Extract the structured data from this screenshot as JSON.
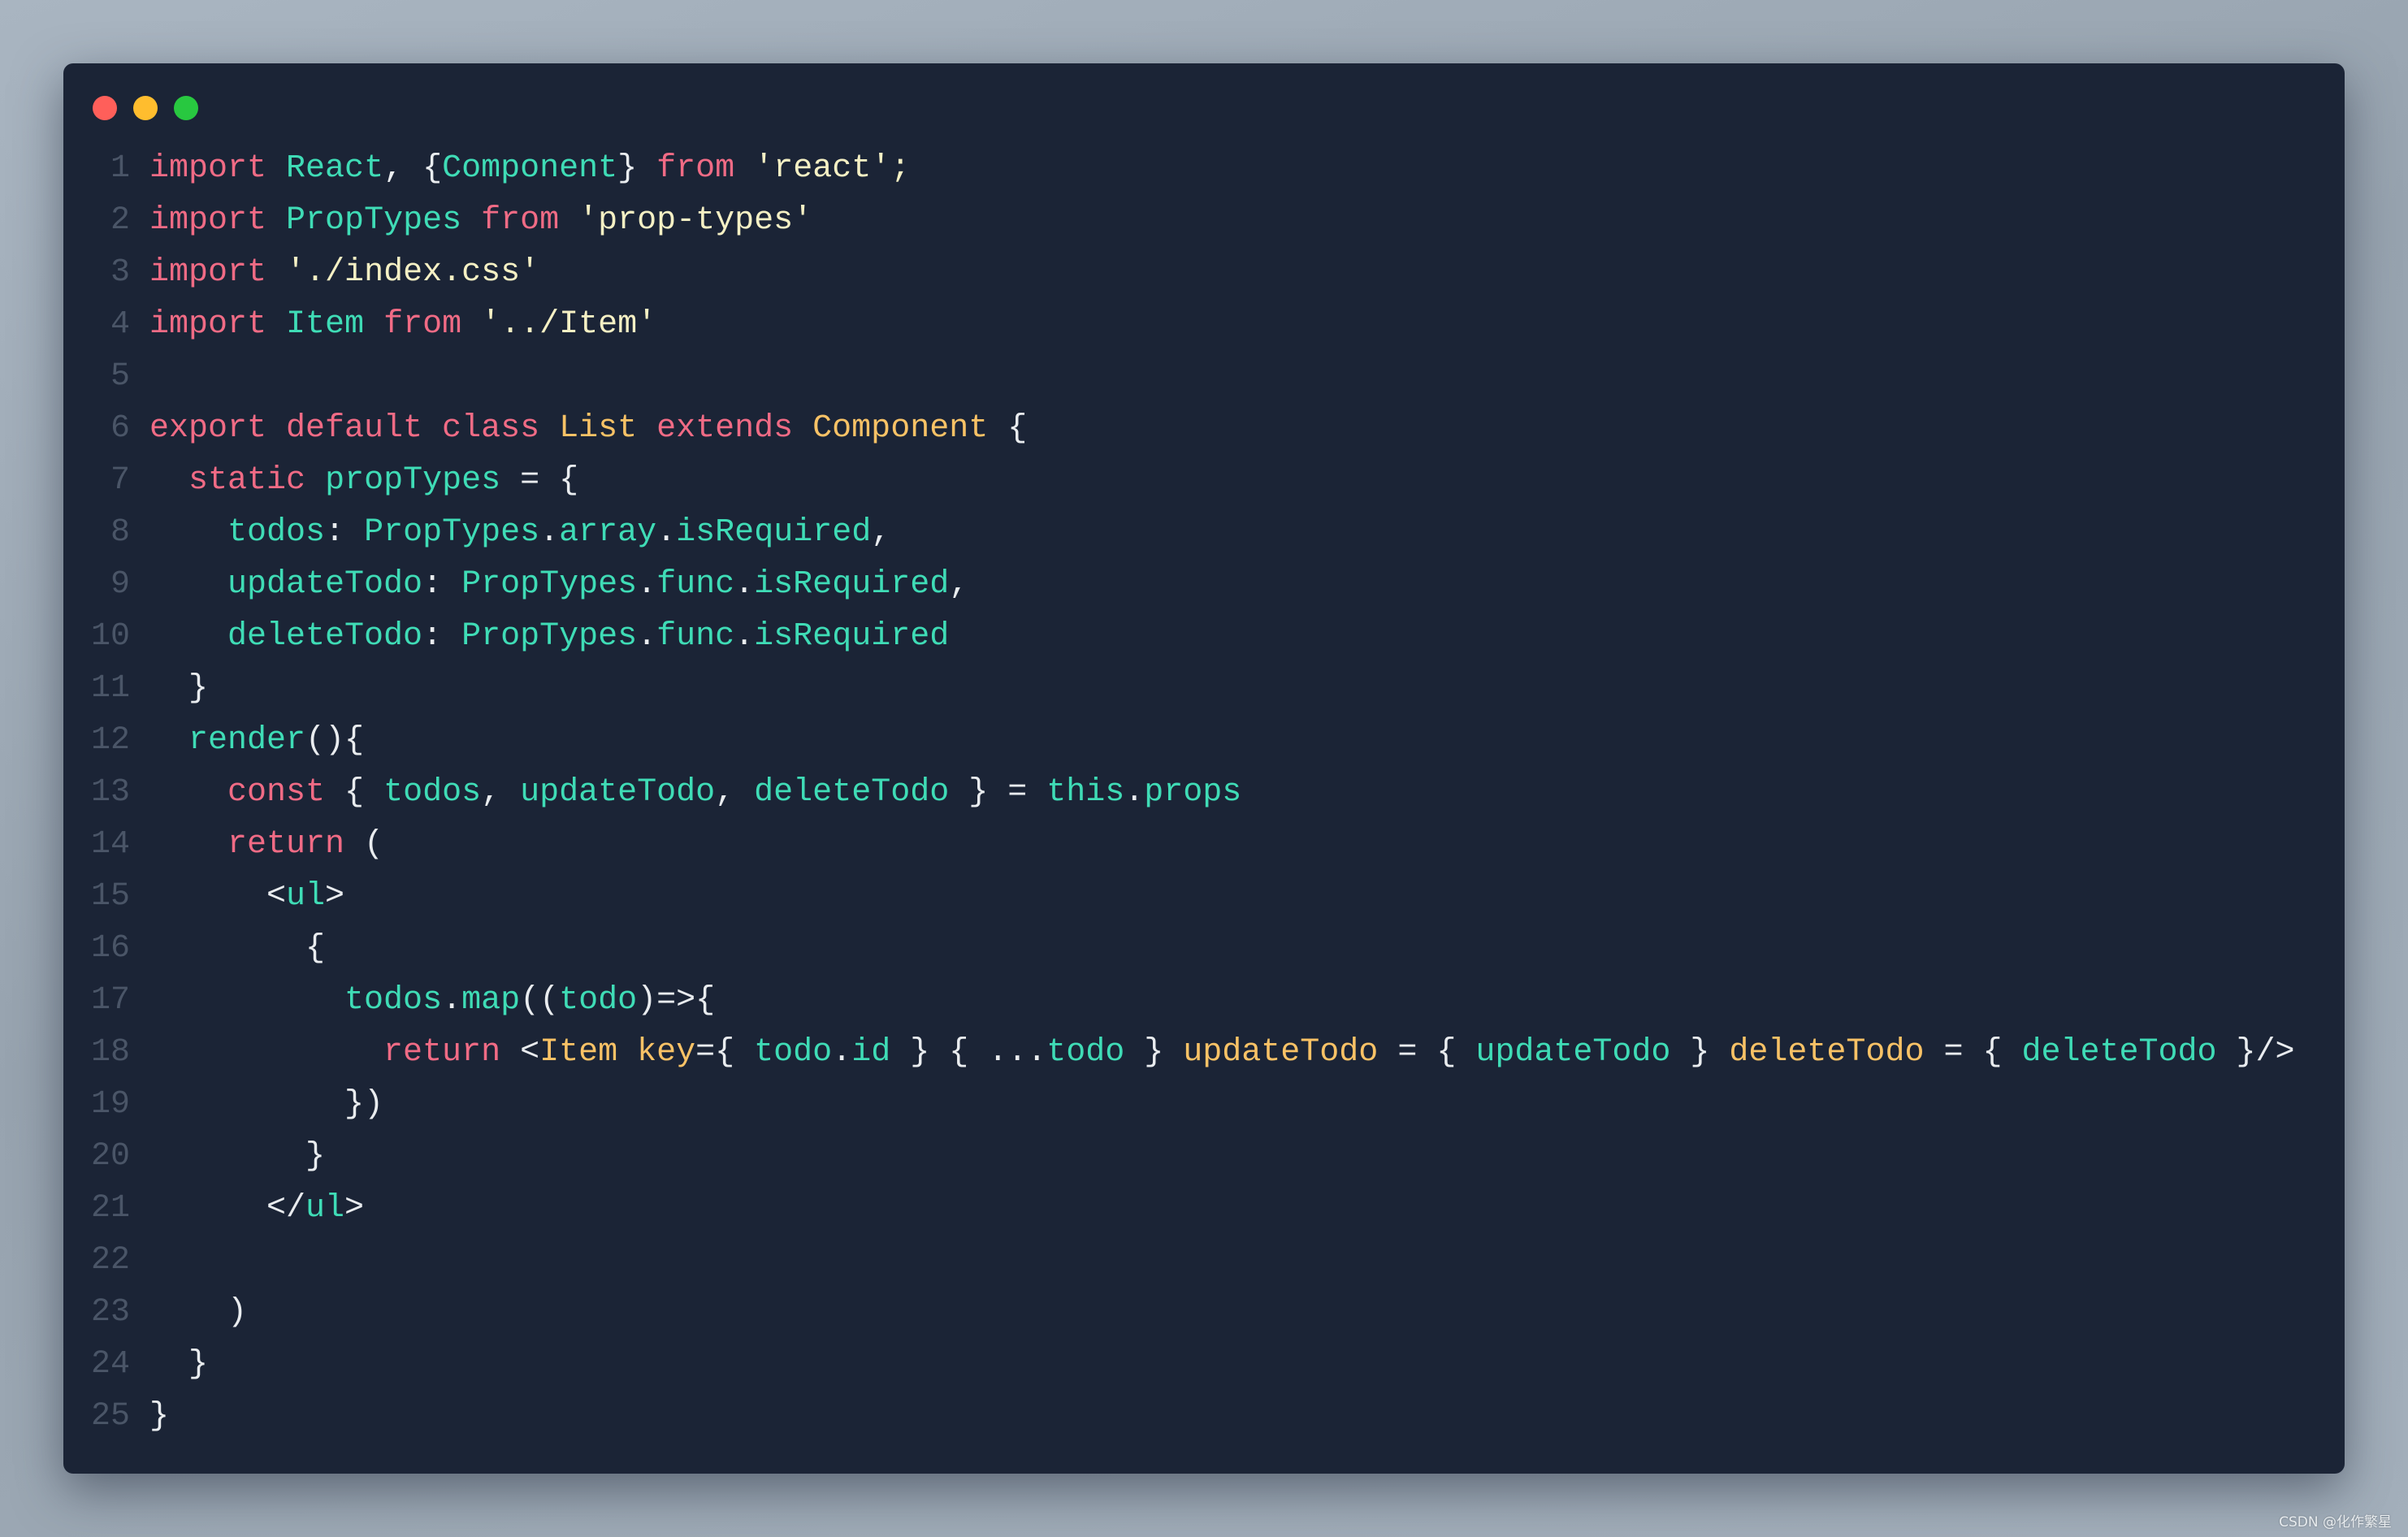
{
  "window": {
    "controls": [
      {
        "name": "close-button",
        "color": "#ff5f5a"
      },
      {
        "name": "minimize-button",
        "color": "#ffbd2e"
      },
      {
        "name": "maximize-button",
        "color": "#28c840"
      }
    ]
  },
  "colors": {
    "background": "#1b2436",
    "keyword": "#f06b85",
    "identifier": "#3fdcb6",
    "string": "#f5f0c4",
    "class": "#f8c266",
    "punctuation": "#e9ecef",
    "line_number": "#4a5567"
  },
  "code": {
    "language": "javascript",
    "lines": [
      {
        "n": "1",
        "tokens": [
          [
            "kw",
            "import"
          ],
          [
            "p",
            " "
          ],
          [
            "id",
            "React"
          ],
          [
            "p",
            ", {"
          ],
          [
            "id",
            "Component"
          ],
          [
            "p",
            "} "
          ],
          [
            "kw",
            "from"
          ],
          [
            "p",
            " "
          ],
          [
            "str",
            "'react';"
          ]
        ]
      },
      {
        "n": "2",
        "tokens": [
          [
            "kw",
            "import"
          ],
          [
            "p",
            " "
          ],
          [
            "id",
            "PropTypes"
          ],
          [
            "p",
            " "
          ],
          [
            "kw",
            "from"
          ],
          [
            "p",
            " "
          ],
          [
            "str",
            "'prop-types'"
          ]
        ]
      },
      {
        "n": "3",
        "tokens": [
          [
            "kw",
            "import"
          ],
          [
            "p",
            " "
          ],
          [
            "str",
            "'./index.css'"
          ]
        ]
      },
      {
        "n": "4",
        "tokens": [
          [
            "kw",
            "import"
          ],
          [
            "p",
            " "
          ],
          [
            "id",
            "Item"
          ],
          [
            "p",
            " "
          ],
          [
            "kw",
            "from"
          ],
          [
            "p",
            " "
          ],
          [
            "str",
            "'../Item'"
          ]
        ]
      },
      {
        "n": "5",
        "tokens": []
      },
      {
        "n": "6",
        "tokens": [
          [
            "kw",
            "export default class"
          ],
          [
            "p",
            " "
          ],
          [
            "cls",
            "List"
          ],
          [
            "p",
            " "
          ],
          [
            "kw",
            "extends"
          ],
          [
            "p",
            " "
          ],
          [
            "cls",
            "Component"
          ],
          [
            "p",
            " {"
          ]
        ]
      },
      {
        "n": "7",
        "tokens": [
          [
            "p",
            "  "
          ],
          [
            "kw",
            "static"
          ],
          [
            "p",
            " "
          ],
          [
            "id",
            "propTypes"
          ],
          [
            "p",
            " = {"
          ]
        ]
      },
      {
        "n": "8",
        "tokens": [
          [
            "p",
            "    "
          ],
          [
            "id",
            "todos"
          ],
          [
            "p",
            ": "
          ],
          [
            "id",
            "PropTypes"
          ],
          [
            "p",
            "."
          ],
          [
            "id",
            "array"
          ],
          [
            "p",
            "."
          ],
          [
            "id",
            "isRequired"
          ],
          [
            "p",
            ","
          ]
        ]
      },
      {
        "n": "9",
        "tokens": [
          [
            "p",
            "    "
          ],
          [
            "id",
            "updateTodo"
          ],
          [
            "p",
            ": "
          ],
          [
            "id",
            "PropTypes"
          ],
          [
            "p",
            "."
          ],
          [
            "id",
            "func"
          ],
          [
            "p",
            "."
          ],
          [
            "id",
            "isRequired"
          ],
          [
            "p",
            ","
          ]
        ]
      },
      {
        "n": "10",
        "tokens": [
          [
            "p",
            "    "
          ],
          [
            "id",
            "deleteTodo"
          ],
          [
            "p",
            ": "
          ],
          [
            "id",
            "PropTypes"
          ],
          [
            "p",
            "."
          ],
          [
            "id",
            "func"
          ],
          [
            "p",
            "."
          ],
          [
            "id",
            "isRequired"
          ]
        ]
      },
      {
        "n": "11",
        "tokens": [
          [
            "p",
            "  }"
          ]
        ]
      },
      {
        "n": "12",
        "tokens": [
          [
            "p",
            "  "
          ],
          [
            "id",
            "render"
          ],
          [
            "p",
            "(){"
          ]
        ]
      },
      {
        "n": "13",
        "tokens": [
          [
            "p",
            "    "
          ],
          [
            "kw",
            "const"
          ],
          [
            "p",
            " { "
          ],
          [
            "id",
            "todos"
          ],
          [
            "p",
            ", "
          ],
          [
            "id",
            "updateTodo"
          ],
          [
            "p",
            ", "
          ],
          [
            "id",
            "deleteTodo"
          ],
          [
            "p",
            " } = "
          ],
          [
            "id",
            "this"
          ],
          [
            "p",
            "."
          ],
          [
            "id",
            "props"
          ]
        ]
      },
      {
        "n": "14",
        "tokens": [
          [
            "p",
            "    "
          ],
          [
            "kw",
            "return"
          ],
          [
            "p",
            " ("
          ]
        ]
      },
      {
        "n": "15",
        "tokens": [
          [
            "p",
            "      <"
          ],
          [
            "id",
            "ul"
          ],
          [
            "p",
            ">"
          ]
        ]
      },
      {
        "n": "16",
        "tokens": [
          [
            "p",
            "        {"
          ]
        ]
      },
      {
        "n": "17",
        "tokens": [
          [
            "p",
            "          "
          ],
          [
            "id",
            "todos"
          ],
          [
            "p",
            "."
          ],
          [
            "id",
            "map"
          ],
          [
            "p",
            "(("
          ],
          [
            "id",
            "todo"
          ],
          [
            "p",
            ")=>{"
          ]
        ]
      },
      {
        "n": "18",
        "tokens": [
          [
            "p",
            "            "
          ],
          [
            "kw",
            "return"
          ],
          [
            "p",
            " <"
          ],
          [
            "cls",
            "Item"
          ],
          [
            "p",
            " "
          ],
          [
            "cls",
            "key"
          ],
          [
            "p",
            "={ "
          ],
          [
            "id",
            "todo"
          ],
          [
            "p",
            "."
          ],
          [
            "id",
            "id"
          ],
          [
            "p",
            " } { ..."
          ],
          [
            "id",
            "todo"
          ],
          [
            "p",
            " } "
          ],
          [
            "cls",
            "updateTodo"
          ],
          [
            "p",
            " = { "
          ],
          [
            "id",
            "updateTodo"
          ],
          [
            "p",
            " } "
          ],
          [
            "cls",
            "deleteTodo"
          ],
          [
            "p",
            " = { "
          ],
          [
            "id",
            "deleteTodo"
          ],
          [
            "p",
            " }/>"
          ]
        ]
      },
      {
        "n": "19",
        "tokens": [
          [
            "p",
            "          })"
          ]
        ]
      },
      {
        "n": "20",
        "tokens": [
          [
            "p",
            "        }"
          ]
        ]
      },
      {
        "n": "21",
        "tokens": [
          [
            "p",
            "      </"
          ],
          [
            "id",
            "ul"
          ],
          [
            "p",
            ">"
          ]
        ]
      },
      {
        "n": "22",
        "tokens": []
      },
      {
        "n": "23",
        "tokens": [
          [
            "p",
            "    )"
          ]
        ]
      },
      {
        "n": "24",
        "tokens": [
          [
            "p",
            "  }"
          ]
        ]
      },
      {
        "n": "25",
        "tokens": [
          [
            "p",
            "}"
          ]
        ]
      }
    ]
  },
  "watermark": "CSDN @化作繁星"
}
